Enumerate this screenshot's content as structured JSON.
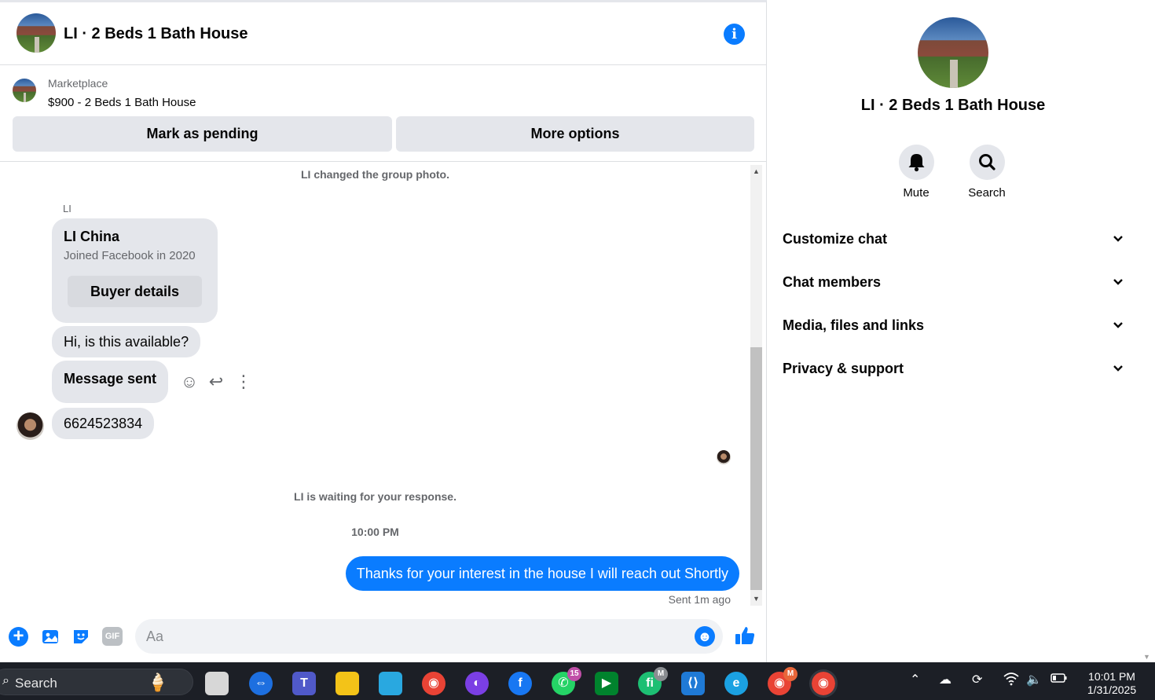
{
  "chat": {
    "title": "LI · 2 Beds 1 Bath House",
    "marketplace": {
      "label": "Marketplace",
      "listing": "$900 - 2 Beds 1 Bath House",
      "pending_button": "Mark as pending",
      "more_button": "More options"
    },
    "messages": {
      "system_photo": "LI changed the group photo.",
      "sender": "LI",
      "card": {
        "name": "LI China",
        "subtitle": "Joined Facebook in 2020",
        "button": "Buyer details"
      },
      "msg1": "Hi, is this available?",
      "msg2": "Message sent",
      "msg3": "6624523834",
      "waiting": "LI is waiting for your response.",
      "time": "10:00 PM",
      "outgoing": "Thanks for your interest in the house I will reach out Shortly",
      "sent_status": "Sent 1m ago"
    },
    "composer": {
      "placeholder": "Aa",
      "gif_label": "GIF"
    }
  },
  "side": {
    "title": "LI · 2 Beds 1 Bath House",
    "actions": [
      {
        "label": "Mute",
        "icon": "bell-icon"
      },
      {
        "label": "Search",
        "icon": "search-icon"
      }
    ],
    "sections": [
      "Customize chat",
      "Chat members",
      "Media, files and links",
      "Privacy & support"
    ]
  },
  "taskbar": {
    "search_label": "Search",
    "whatsapp_badge": "15",
    "fiverr_badge": "M",
    "chrome_badge": "M",
    "time": "10:01 PM",
    "date": "1/31/2025"
  },
  "colors": {
    "accent": "#0a7cff",
    "bubble_gray": "#e4e6eb",
    "taskbar": "#1c1f26"
  }
}
